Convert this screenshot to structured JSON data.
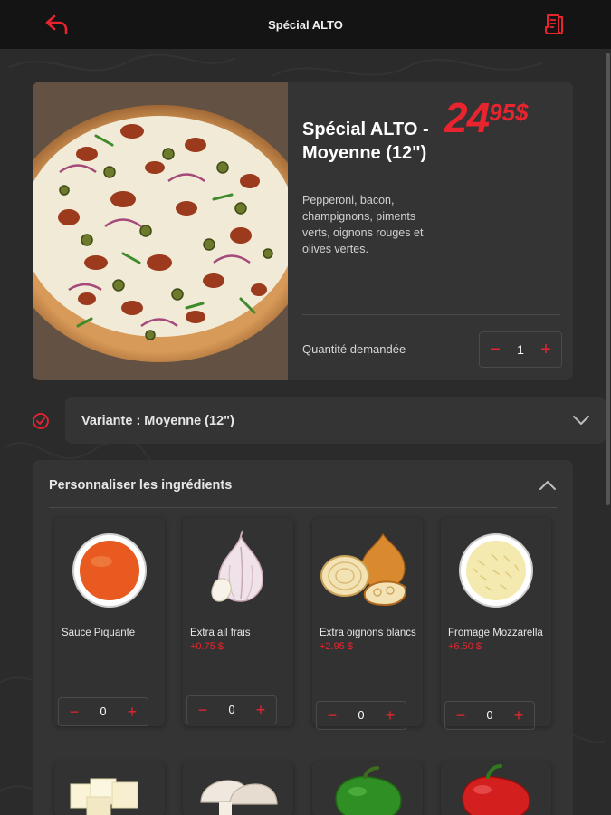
{
  "header": {
    "title": "Spécial ALTO",
    "back_icon": "back-arrow-icon",
    "receipt_icon": "receipt-icon"
  },
  "colors": {
    "accent": "#e8242e",
    "background": "#2b2b2b",
    "card": "#343434",
    "topbar": "#141414"
  },
  "product": {
    "name": "Spécial ALTO - Moyenne (12\")",
    "price_int": "24",
    "price_cents": "95",
    "currency": "$",
    "description": "Pepperoni, bacon, champignons, piments verts, oignons rouges et olives vertes.",
    "quantity_label": "Quantité demandée",
    "quantity": "1",
    "minus": "−",
    "plus": "+"
  },
  "variant": {
    "label": "Variante : Moyenne (12\")"
  },
  "ingredients": {
    "title": "Personnaliser les ingrédients",
    "items": [
      {
        "name": "Sauce Piquante",
        "extra": "",
        "quantity": "0",
        "icon": "hot-sauce-bowl-icon"
      },
      {
        "name": "Extra ail frais",
        "extra": "+0.75 $",
        "quantity": "0",
        "icon": "garlic-icon"
      },
      {
        "name": "Extra oignons blancs",
        "extra": "+2.95 $",
        "quantity": "0",
        "icon": "onion-icon"
      },
      {
        "name": "Fromage Mozzarella",
        "extra": "+6.50 $",
        "quantity": "0",
        "icon": "mozzarella-bowl-icon"
      }
    ],
    "row2_icons": [
      "feta-cheese-icon",
      "mushroom-icon",
      "green-pepper-icon",
      "red-pepper-icon"
    ]
  }
}
